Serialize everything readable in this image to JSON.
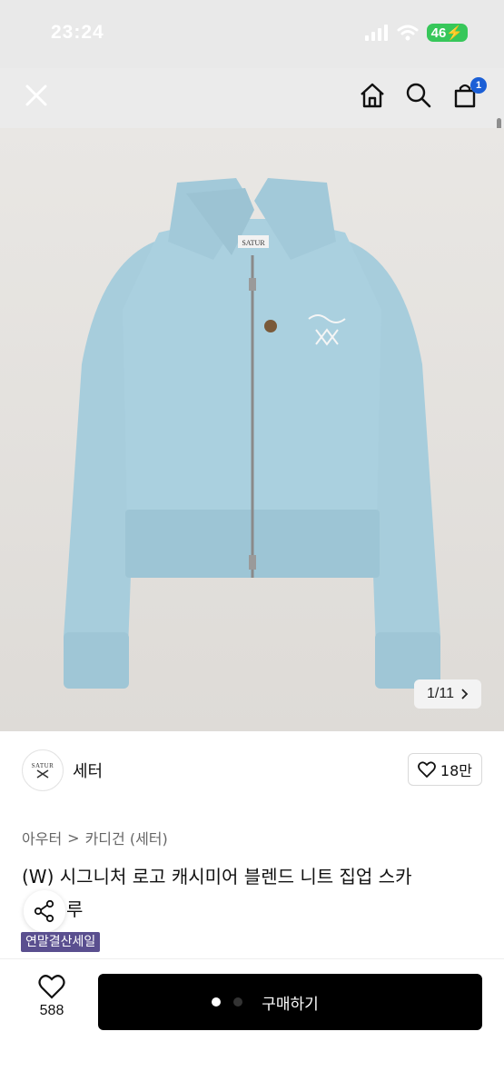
{
  "status_bar": {
    "time": "23:24",
    "network": "46",
    "battery_icon": "battery-charging"
  },
  "header": {
    "close_icon": "close-icon",
    "home_icon": "home-icon",
    "search_icon": "search-icon",
    "cart_icon": "shopping-bag-icon",
    "cart_count": "1"
  },
  "image": {
    "counter": "1/11",
    "next_icon": "chevron-right-icon",
    "brand_label": "SATUR"
  },
  "brand": {
    "logo_text": "SATUR",
    "name": "세터",
    "likes": "18만"
  },
  "breadcrumb": {
    "level1": "아우터",
    "separator": ">",
    "level2": "카디건 (세터)"
  },
  "product": {
    "title_line1": "(W) 시그니처 로고 캐시미어 블렌드 니트 집업 스카",
    "title_line2": "루",
    "badge": "연말결산세일"
  },
  "bottom_bar": {
    "wish_count": "588",
    "buy_label": "구매하기"
  },
  "colors": {
    "accent": "#1b5fd6",
    "badge_bg": "#5a4f8f",
    "sweater": "#a9cedd"
  }
}
